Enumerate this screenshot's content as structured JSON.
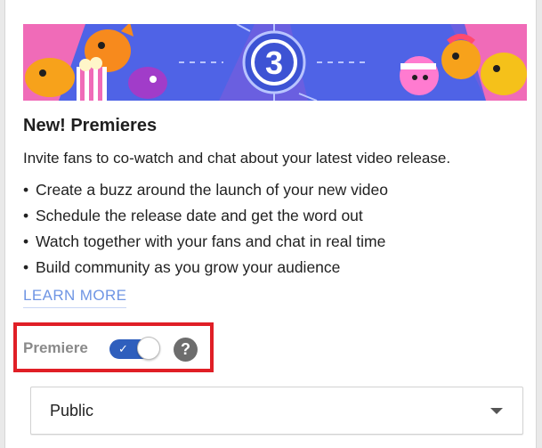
{
  "banner": {
    "countdown_number": "3",
    "colors": {
      "background": "#6a5fe0",
      "center_circle": "#3d53d4",
      "ring": "#b9c4ff"
    }
  },
  "card": {
    "title": "New! Premieres",
    "description": "Invite fans to co-watch and chat about your latest video release.",
    "bullets": [
      "Create a buzz around the launch of your new video",
      "Schedule the release date and get the word out",
      "Watch together with your fans and chat in real time",
      "Build community as you grow your audience"
    ],
    "bullet_symbol": "•",
    "learn_more": "LEARN MORE"
  },
  "premiere": {
    "label": "Premiere",
    "toggle_on": true,
    "toggle_check": "✓",
    "help_glyph": "?",
    "highlight_color": "#e01f26"
  },
  "visibility": {
    "selected": "Public"
  },
  "icons": [
    "check-icon",
    "help-icon",
    "dropdown-arrow-icon"
  ]
}
